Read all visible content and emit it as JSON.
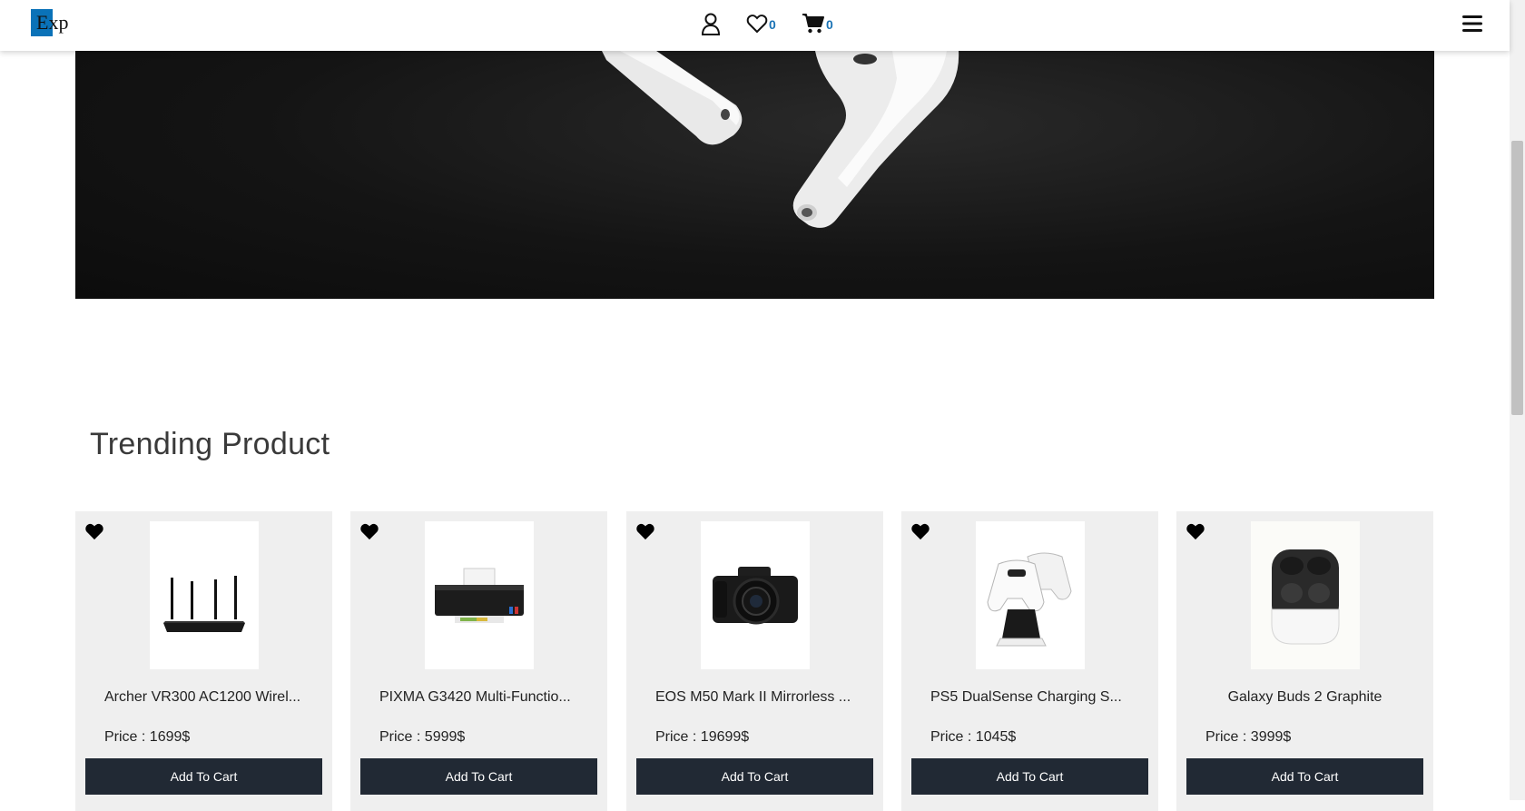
{
  "header": {
    "logo_text": "Exp",
    "wishlist_count": "0",
    "cart_count": "0",
    "icons": [
      "user-icon",
      "heart-icon",
      "cart-icon",
      "menu-icon"
    ]
  },
  "colors": {
    "accent": "#1a73b5",
    "button_bg": "#212934",
    "card_bg": "#efefef"
  },
  "trending": {
    "title": "Trending Product",
    "products": [
      {
        "name": "Archer VR300 AC1200 Wirel...",
        "price": "Price : 1699$",
        "button": "Add To Cart"
      },
      {
        "name": "PIXMA G3420 Multi-Functio...",
        "price": "Price : 5999$",
        "button": "Add To Cart"
      },
      {
        "name": "EOS M50 Mark II Mirrorless ...",
        "price": "Price : 19699$",
        "button": "Add To Cart"
      },
      {
        "name": "PS5 DualSense Charging S...",
        "price": "Price : 1045$",
        "button": "Add To Cart"
      },
      {
        "name": "Galaxy Buds 2 Graphite",
        "price": "Price : 3999$",
        "button": "Add To Cart"
      }
    ]
  }
}
